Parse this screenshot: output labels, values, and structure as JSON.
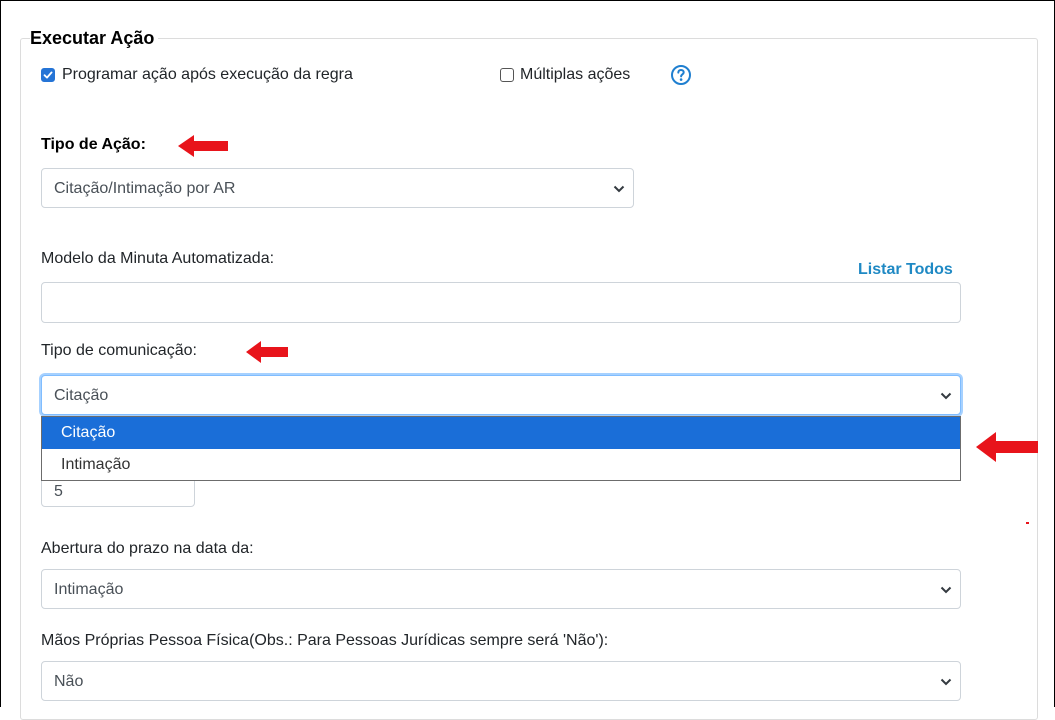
{
  "section": {
    "legend": "Executar Ação"
  },
  "options": {
    "schedule_label": "Programar ação após execução da regra",
    "schedule_checked": true,
    "multiple_label": "Múltiplas ações",
    "multiple_checked": false
  },
  "action_type": {
    "label": "Tipo de Ação:",
    "value": "Citação/Intimação por AR"
  },
  "template": {
    "label": "Modelo da Minuta Automatizada:",
    "list_all": "Listar Todos",
    "value": ""
  },
  "communication": {
    "label": "Tipo de comunicação:",
    "value": "Citação",
    "options": [
      "Citação",
      "Intimação"
    ],
    "selected_index": 0
  },
  "deadline": {
    "value": "5"
  },
  "opening": {
    "label": "Abertura do prazo na data da:",
    "value": "Intimação"
  },
  "own_hands": {
    "label": "Mãos Próprias Pessoa Física(Obs.: Para Pessoas Jurídicas sempre será 'Não'):",
    "value": "Não"
  },
  "colors": {
    "accent": "#1a6ed8",
    "link": "#1f89c4",
    "arrow": "#e8141b",
    "checkbox": "#2574d6"
  }
}
